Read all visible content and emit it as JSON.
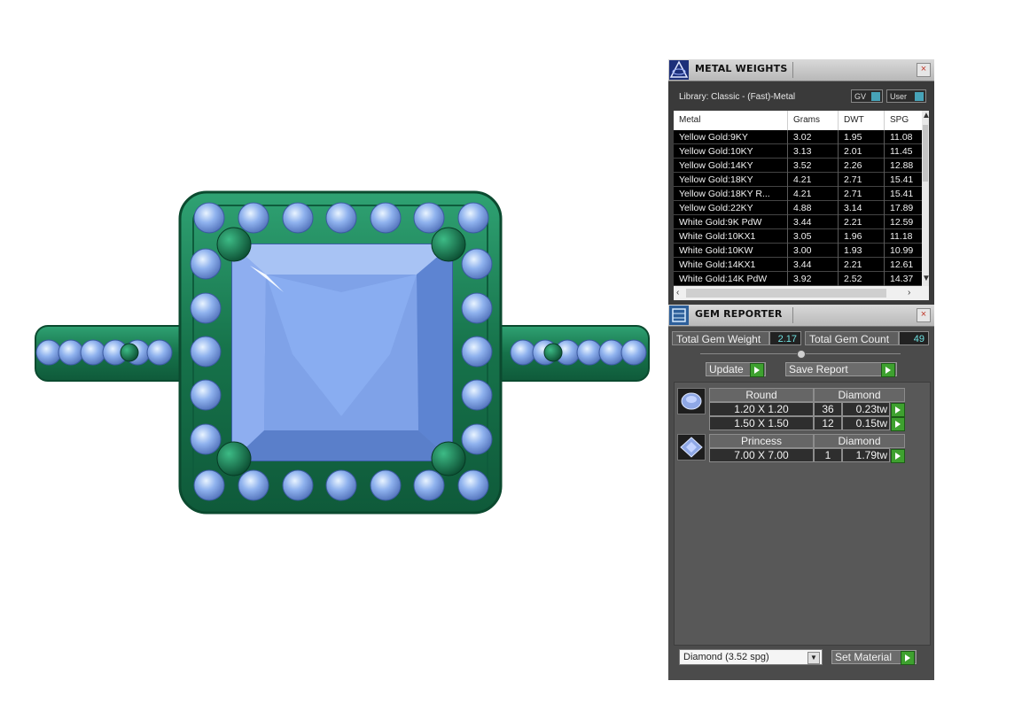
{
  "metal_weights": {
    "title": "METAL WEIGHTS",
    "close": "×",
    "library": "Library: Classic - (Fast)-Metal",
    "gv_label": "GV",
    "user_label": "User",
    "columns": [
      "Metal",
      "Grams",
      "DWT",
      "SPG"
    ],
    "rows": [
      [
        "Yellow Gold:9KY",
        "3.02",
        "1.95",
        "11.08"
      ],
      [
        "Yellow Gold:10KY",
        "3.13",
        "2.01",
        "11.45"
      ],
      [
        "Yellow Gold:14KY",
        "3.52",
        "2.26",
        "12.88"
      ],
      [
        "Yellow Gold:18KY",
        "4.21",
        "2.71",
        "15.41"
      ],
      [
        "Yellow Gold:18KY R...",
        "4.21",
        "2.71",
        "15.41"
      ],
      [
        "Yellow Gold:22KY",
        "4.88",
        "3.14",
        "17.89"
      ],
      [
        "White Gold:9K PdW",
        "3.44",
        "2.21",
        "12.59"
      ],
      [
        "White Gold:10KX1",
        "3.05",
        "1.96",
        "11.18"
      ],
      [
        "White Gold:10KW",
        "3.00",
        "1.93",
        "10.99"
      ],
      [
        "White Gold:14KX1",
        "3.44",
        "2.21",
        "12.61"
      ],
      [
        "White Gold:14K PdW",
        "3.92",
        "2.52",
        "14.37"
      ]
    ]
  },
  "gem_reporter": {
    "title": "GEM REPORTER",
    "close": "×",
    "total_weight_label": "Total Gem Weight",
    "total_weight": "2.17",
    "total_count_label": "Total Gem Count",
    "total_count": "49",
    "update_label": "Update",
    "save_report_label": "Save Report",
    "groups": [
      {
        "shape": "Round",
        "material": "Diamond",
        "items": [
          {
            "size": "1.20 X 1.20",
            "count": "36",
            "weight": "0.23tw"
          },
          {
            "size": "1.50 X 1.50",
            "count": "12",
            "weight": "0.15tw"
          }
        ]
      },
      {
        "shape": "Princess",
        "material": "Diamond",
        "items": [
          {
            "size": "7.00 X 7.00",
            "count": "1",
            "weight": "1.79tw"
          }
        ]
      }
    ],
    "material_select": "Diamond     (3.52 spg)",
    "set_material_label": "Set Material"
  },
  "colors": {
    "metal": "#1f8a5c",
    "gem": "#7ea6e8",
    "panel": "#4b4b4b",
    "value_text": "#6fe0e0",
    "go_button": "#3ea12f"
  }
}
